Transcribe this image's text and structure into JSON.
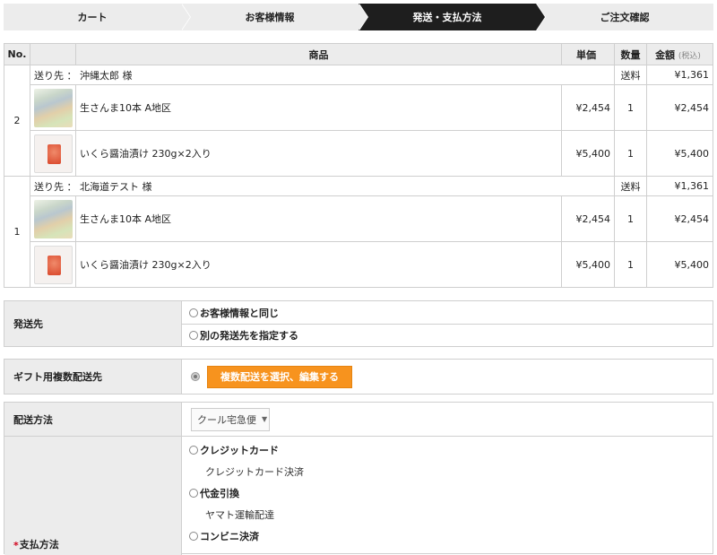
{
  "steps": [
    "カート",
    "お客様情報",
    "発送・支払方法",
    "ご注文確認"
  ],
  "table": {
    "headers": {
      "no": "No.",
      "product": "商品",
      "price": "単価",
      "qty": "数量",
      "amount": "金額",
      "tax_note": "(税込)"
    },
    "groups": [
      {
        "no": "2",
        "ship_to": "送り先 ： 沖縄太郎 様",
        "ship_label": "送料",
        "ship_fee": "¥1,361",
        "items": [
          {
            "name": "生さんま10本 A地区",
            "price": "¥2,454",
            "qty": "1",
            "amount": "¥2,454",
            "image": "fish"
          },
          {
            "name": "いくら醤油漬け 230g×2入り",
            "price": "¥5,400",
            "qty": "1",
            "amount": "¥5,400",
            "image": "ikura"
          }
        ]
      },
      {
        "no": "1",
        "ship_to": "送り先 ： 北海道テスト 様",
        "ship_label": "送料",
        "ship_fee": "¥1,361",
        "items": [
          {
            "name": "生さんま10本 A地区",
            "price": "¥2,454",
            "qty": "1",
            "amount": "¥2,454",
            "image": "fish"
          },
          {
            "name": "いくら醤油漬け 230g×2入り",
            "price": "¥5,400",
            "qty": "1",
            "amount": "¥5,400",
            "image": "ikura"
          }
        ]
      }
    ]
  },
  "shipping_dest": {
    "label": "発送先",
    "options": [
      "お客様情報と同じ",
      "別の発送先を指定する"
    ]
  },
  "gift": {
    "label": "ギフト用複数配送先",
    "button": "複数配送を選択、編集する"
  },
  "delivery": {
    "label": "配送方法",
    "selected": "クール宅急便"
  },
  "payment": {
    "required_mark": "*",
    "label": "支払方法",
    "options": [
      {
        "name": "クレジットカード",
        "sub": "クレジットカード決済"
      },
      {
        "name": "代金引換",
        "sub": "ヤマト運輸配達"
      },
      {
        "name": "コンビニ決済",
        "sub": ""
      }
    ]
  },
  "colors": {
    "accent": "#f7931e",
    "active_step": "#1e1e1e",
    "header_bg": "#ececec"
  }
}
